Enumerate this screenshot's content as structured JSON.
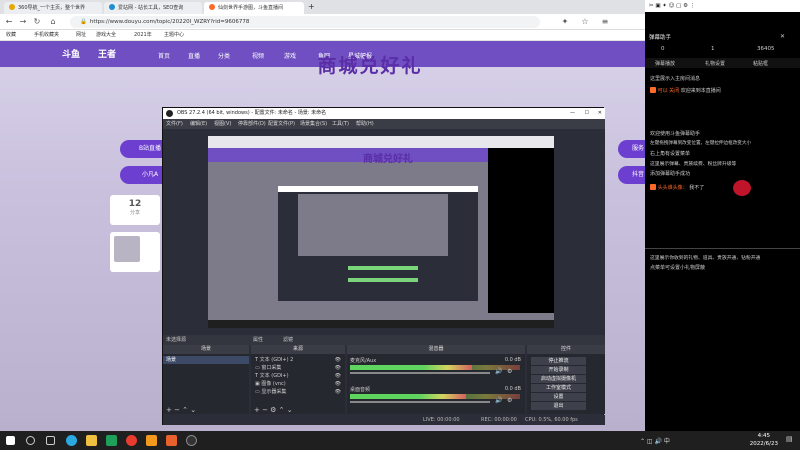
{
  "browser": {
    "tabs": [
      {
        "label": "360导航_一个主页，整个世界",
        "color": "#e4a800"
      },
      {
        "label": "爱站网 - 站长工具，SEO查询",
        "color": "#1c8fd1"
      },
      {
        "label": "仙剑世界手游图，斗鱼直播间",
        "color": "#ff6a2b"
      }
    ],
    "new_tab": "+",
    "url": "https://www.douyu.com/topic/20220I_WZRY?rid=9606778",
    "bookmarks": [
      "收藏",
      "手机收藏夹",
      "网址",
      "游戏大全",
      "2021年",
      "主题中心"
    ]
  },
  "site": {
    "logo": "斗鱼",
    "logo2": "王者",
    "nav": [
      "首页",
      "直播",
      "分类",
      "视频",
      "游戏",
      "鱼吧",
      "星城幅报"
    ],
    "hero": "商城兑好礼",
    "pills_left": [
      "B站直播",
      "小凡A"
    ],
    "pills_right": [
      "服务",
      "抖音"
    ],
    "card_num": "12",
    "card_label": "分享"
  },
  "obs": {
    "title": "OBS 27.2.4 (64 bit, windows) - 配置文件: 未命名 - 场景: 未命名",
    "menu": [
      "文件(F)",
      "编辑(E)",
      "视图(V)",
      "停靠部件(D)",
      "配置文件(P)",
      "场景集合(S)",
      "工具(T)",
      "帮助(H)"
    ],
    "preview_label": "未选择源",
    "props_label": "属性",
    "filters_label": "滤镜",
    "docks": {
      "scenes": "场景",
      "sources": "来源",
      "mixer": "混音器",
      "controls": "控件"
    },
    "scene_item": "场景",
    "sources": [
      "文本 (GDI+) 2",
      "窗口采集",
      "文本 (GDI+)",
      "图像 (vnc)",
      "显示器采集"
    ],
    "mixer": [
      {
        "name": "麦克风/Aux",
        "db": "0.0 dB",
        "level": 0.72
      },
      {
        "name": "桌面音频",
        "db": "0.0 dB",
        "level": 0.68
      }
    ],
    "controls": [
      "停止推流",
      "开始录制",
      "启动虚拟摄像机",
      "工作室模式",
      "设置",
      "退出"
    ],
    "status": {
      "live": "LIVE: 00:00:00",
      "rec": "REC: 00:00:00",
      "cpu": "CPU: 0.5%, 60.00 fps"
    }
  },
  "chat": {
    "title": "弹幕助手",
    "stats": [
      "0",
      "1",
      "36405"
    ],
    "tabs": [
      "弹幕播放",
      "礼物设置",
      "粘贴框"
    ],
    "lines": [
      {
        "name": "",
        "text": "这里展示入主房间消息"
      },
      {
        "name": "可以 关闭",
        "text": "欢迎来到本直播间"
      },
      {
        "name": "",
        "text": "欢迎使用斗鱼弹幕助手"
      },
      {
        "name": "",
        "text": "左键拖拽弹幕到改变位置，左键拉伸边框改变大小"
      },
      {
        "name": "",
        "text": "右上角有设置菜单"
      },
      {
        "name": "",
        "text": "这里展示弹幕、贵族续费、粉丝牌升级等"
      },
      {
        "name": "",
        "text": "添加弹幕助手成功"
      },
      {
        "name": "头头谁头像：",
        "text": "我不了"
      },
      {
        "name": "",
        "text": "这里展示你收到的礼物、道具、贵族开通、钻粉开通"
      },
      {
        "name": "",
        "text": "点菜单可设置小礼物屏蔽"
      }
    ]
  },
  "taskbar": {
    "time": "4:45",
    "date": "2022/6/23"
  }
}
